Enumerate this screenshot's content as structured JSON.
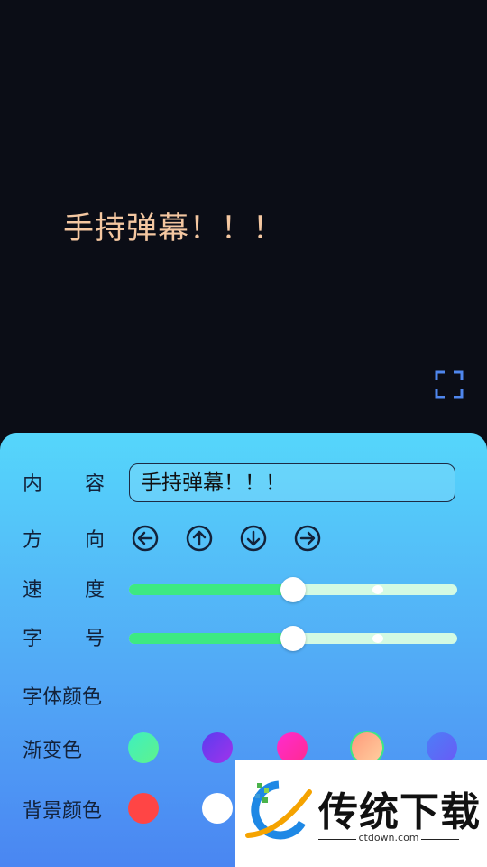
{
  "preview": {
    "text": "手持弹幕！！！",
    "text_color": "#f4c7a1",
    "background": "#0b0d16"
  },
  "fullscreen_icon": "fullscreen-icon",
  "panel": {
    "content": {
      "label": "内　　容",
      "value": "手持弹幕！！！"
    },
    "direction": {
      "label": "方　　向",
      "icons": [
        "arrow-left-circle-icon",
        "arrow-up-circle-icon",
        "arrow-down-circle-icon",
        "arrow-right-circle-icon"
      ]
    },
    "speed": {
      "label": "速　　度",
      "value_fraction": 0.5
    },
    "size": {
      "label": "字　　号",
      "value_fraction": 0.5
    },
    "font_color": {
      "label": "字体颜色"
    },
    "gradient": {
      "label": "渐变色",
      "swatches": [
        "#4df0b0",
        "#7b3cf0",
        "#ff2bbd",
        "#ffb08a",
        "#5b6cf8"
      ]
    },
    "background": {
      "label": "背景颜色",
      "swatches": [
        "#ff4b4b",
        "#ffffff"
      ]
    }
  },
  "watermark": {
    "title": "传统下载",
    "subtitle": "ctdown.com"
  }
}
